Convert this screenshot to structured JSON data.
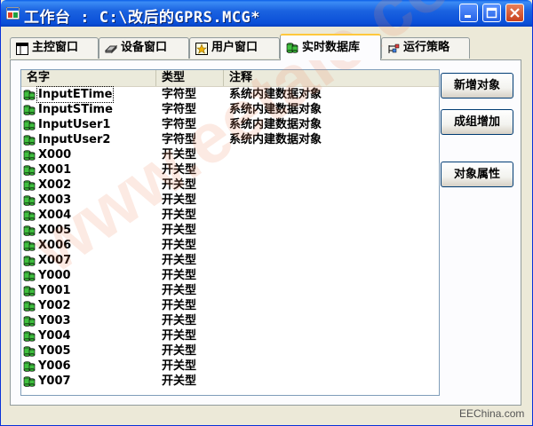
{
  "window": {
    "title": "工作台 : C:\\改后的GPRS.MCG*"
  },
  "tabs": [
    {
      "label": "主控窗口",
      "icon": "main-window-icon"
    },
    {
      "label": "设备窗口",
      "icon": "device-icon"
    },
    {
      "label": "用户窗口",
      "icon": "user-window-icon"
    },
    {
      "label": "实时数据库",
      "icon": "database-icon"
    },
    {
      "label": "运行策略",
      "icon": "strategy-icon"
    }
  ],
  "active_tab": 3,
  "list": {
    "columns": [
      "名字",
      "类型",
      "注释"
    ],
    "rows": [
      {
        "name": "InputETime",
        "type": "字符型",
        "note": "系统内建数据对象"
      },
      {
        "name": "InputSTime",
        "type": "字符型",
        "note": "系统内建数据对象"
      },
      {
        "name": "InputUser1",
        "type": "字符型",
        "note": "系统内建数据对象"
      },
      {
        "name": "InputUser2",
        "type": "字符型",
        "note": "系统内建数据对象"
      },
      {
        "name": "X000",
        "type": "开关型",
        "note": ""
      },
      {
        "name": "X001",
        "type": "开关型",
        "note": ""
      },
      {
        "name": "X002",
        "type": "开关型",
        "note": ""
      },
      {
        "name": "X003",
        "type": "开关型",
        "note": ""
      },
      {
        "name": "X004",
        "type": "开关型",
        "note": ""
      },
      {
        "name": "X005",
        "type": "开关型",
        "note": ""
      },
      {
        "name": "X006",
        "type": "开关型",
        "note": ""
      },
      {
        "name": "X007",
        "type": "开关型",
        "note": ""
      },
      {
        "name": "Y000",
        "type": "开关型",
        "note": ""
      },
      {
        "name": "Y001",
        "type": "开关型",
        "note": ""
      },
      {
        "name": "Y002",
        "type": "开关型",
        "note": ""
      },
      {
        "name": "Y003",
        "type": "开关型",
        "note": ""
      },
      {
        "name": "Y004",
        "type": "开关型",
        "note": ""
      },
      {
        "name": "Y005",
        "type": "开关型",
        "note": ""
      },
      {
        "name": "Y006",
        "type": "开关型",
        "note": ""
      },
      {
        "name": "Y007",
        "type": "开关型",
        "note": ""
      }
    ]
  },
  "buttons": {
    "add": "新增对象",
    "batch": "成组增加",
    "props": "对象属性"
  },
  "watermark": "www.eetaic.com",
  "footer_watermark": "EEChina.com",
  "colors": {
    "titlebar": "#0a4fd8",
    "accent_tab": "#ffc83c",
    "close": "#c8401c"
  }
}
